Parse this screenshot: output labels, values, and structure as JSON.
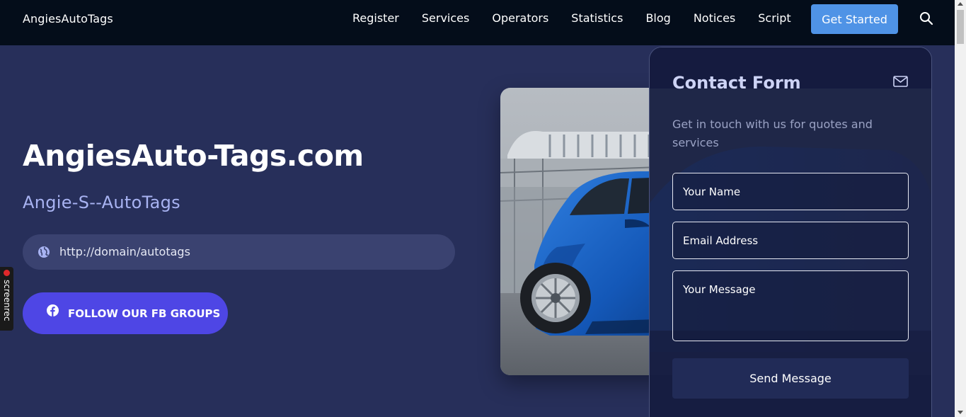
{
  "nav": {
    "brand": "AngiesAutoTags",
    "links": [
      "Register",
      "Services",
      "Operators",
      "Statistics",
      "Blog",
      "Notices",
      "Script"
    ],
    "cta": "Get Started",
    "search_icon": "search-icon"
  },
  "hero": {
    "title": "AngiesAuto-Tags.com",
    "subtitle": "Angie-S--AutoTags",
    "url": "http://domain/autotags",
    "url_icon": "globe-icon",
    "fb_button": "FOLLOW OUR FB GROUPS",
    "fb_icon": "facebook-icon"
  },
  "screenrec": {
    "label": "screenrec"
  },
  "contact": {
    "title": "Contact Form",
    "icon": "mail-icon",
    "description": "Get in touch with us for quotes and services",
    "name_placeholder": "Your Name",
    "email_placeholder": "Email Address",
    "message_placeholder": "Your Message",
    "submit": "Send Message"
  },
  "colors": {
    "nav_bg": "#040d1a",
    "page_bg": "#272f5a",
    "accent_blue": "#4f93e6",
    "fb_button": "#4e46e5",
    "subtitle": "#a8b3f2"
  }
}
